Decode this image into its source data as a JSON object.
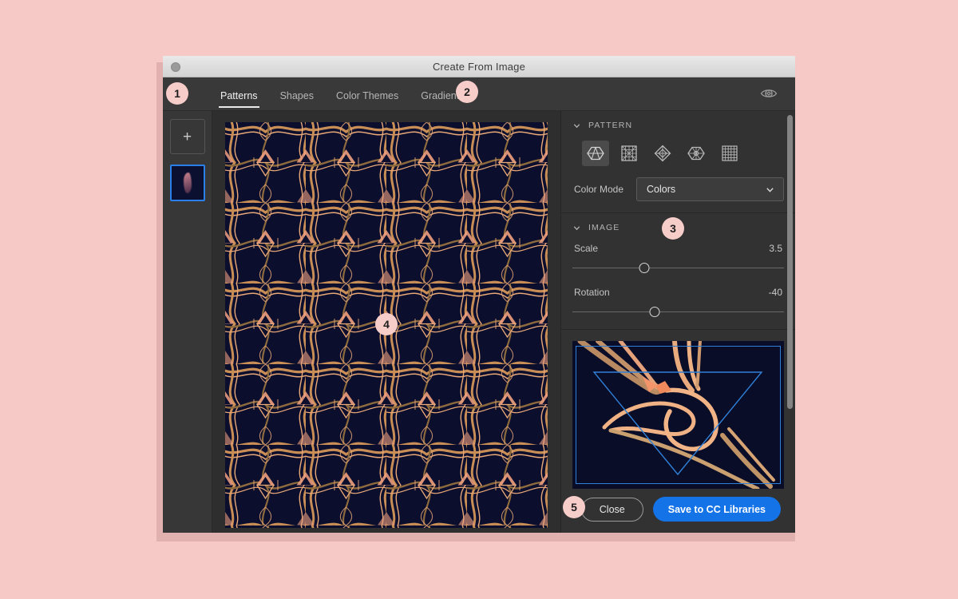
{
  "window": {
    "title": "Create From Image",
    "close_dot": "window-close-dot"
  },
  "tabs": [
    {
      "label": "Patterns",
      "active": true
    },
    {
      "label": "Shapes",
      "active": false
    },
    {
      "label": "Color Themes",
      "active": false
    },
    {
      "label": "Gradients",
      "active": false
    }
  ],
  "topbar": {
    "preview_icon": "eye-icon"
  },
  "left_rail": {
    "add_label": "+",
    "source_thumbnail_name": "source-image-thumbnail"
  },
  "canvas": {
    "name": "pattern-preview-canvas",
    "background": "#0b0e2c",
    "line_colors": [
      "#e9a878",
      "#f0a07e",
      "#c98e56",
      "#8d6a3e"
    ]
  },
  "pattern_section": {
    "title": "PATTERN",
    "types": [
      {
        "name": "hexagon-pie-pattern-icon",
        "selected": true
      },
      {
        "name": "square-radial-pattern-icon",
        "selected": false
      },
      {
        "name": "diamond-pattern-icon",
        "selected": false
      },
      {
        "name": "hexagon-burst-pattern-icon",
        "selected": false
      },
      {
        "name": "grid-pattern-icon",
        "selected": false
      }
    ],
    "color_mode_label": "Color Mode",
    "color_mode_value": "Colors",
    "color_mode_options": [
      "Colors"
    ]
  },
  "image_section": {
    "title": "IMAGE",
    "sliders": [
      {
        "label": "Scale",
        "value": "3.5",
        "percent": 34
      },
      {
        "label": "Rotation",
        "value": "-40",
        "percent": 39
      }
    ]
  },
  "preview": {
    "name": "image-crop-preview",
    "frame_color": "#2f80d8"
  },
  "footer": {
    "close_label": "Close",
    "save_label": "Save to CC Libraries",
    "save_color": "#1473e6"
  },
  "annotations": [
    {
      "id": "1",
      "target": "left-rail"
    },
    {
      "id": "2",
      "target": "tabs"
    },
    {
      "id": "3",
      "target": "image-section"
    },
    {
      "id": "4",
      "target": "pattern-canvas"
    },
    {
      "id": "5",
      "target": "footer-buttons"
    }
  ],
  "scrollbar": {
    "name": "right-panel-scrollbar"
  }
}
